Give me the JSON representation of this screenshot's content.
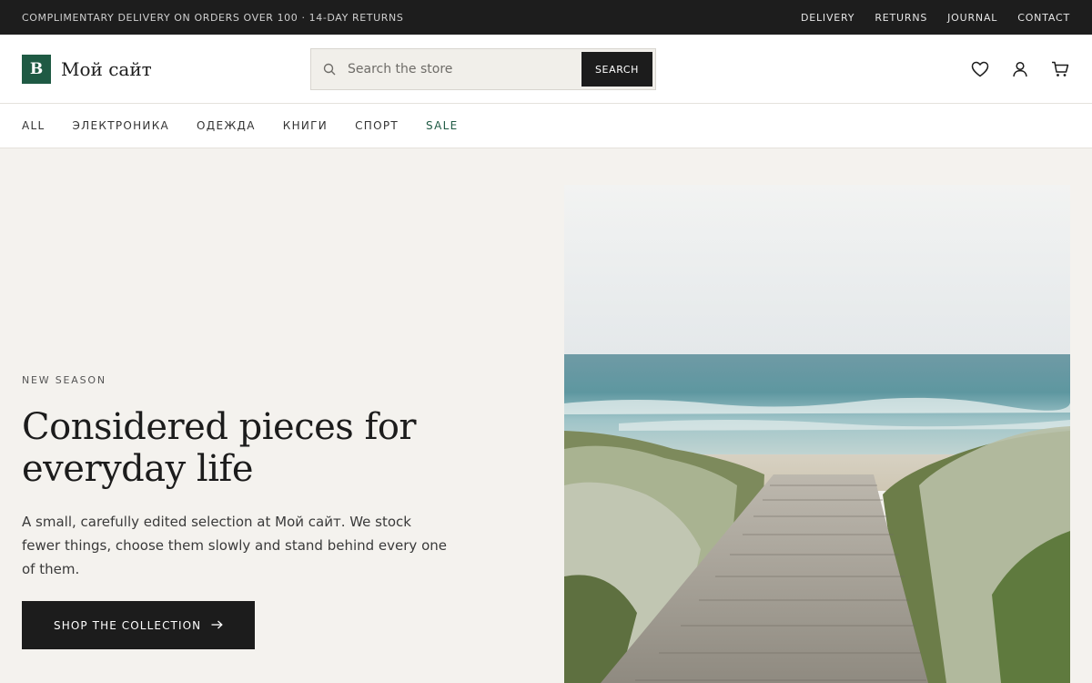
{
  "topbar": {
    "promo": "COMPLIMENTARY DELIVERY ON ORDERS OVER 100 · 14-DAY RETURNS",
    "links": [
      "DELIVERY",
      "RETURNS",
      "JOURNAL",
      "CONTACT"
    ]
  },
  "brand": {
    "mark": "B",
    "name": "Мой сайт",
    "mark_color": "#1f5a44"
  },
  "search": {
    "placeholder": "Search the store",
    "value": "",
    "button": "SEARCH",
    "icon": "search-icon"
  },
  "header_icons": [
    "heart-icon",
    "user-icon",
    "cart-icon"
  ],
  "nav": {
    "items": [
      "ALL",
      "ЭЛЕКТРОНИКА",
      "ОДЕЖДА",
      "КНИГИ",
      "СПОРТ",
      "SALE"
    ],
    "accent": "#1f5a44"
  },
  "hero": {
    "eyebrow": "NEW SEASON",
    "title_line1": "Considered pieces for",
    "title_line2": "everyday life",
    "subtitle": "A small, carefully edited selection at Мой сайт. We stock fewer things, choose them slowly and stand behind every one of them.",
    "cta": "SHOP THE COLLECTION",
    "cta_icon": "arrow-right-icon",
    "image": "beach-boardwalk-photo"
  }
}
